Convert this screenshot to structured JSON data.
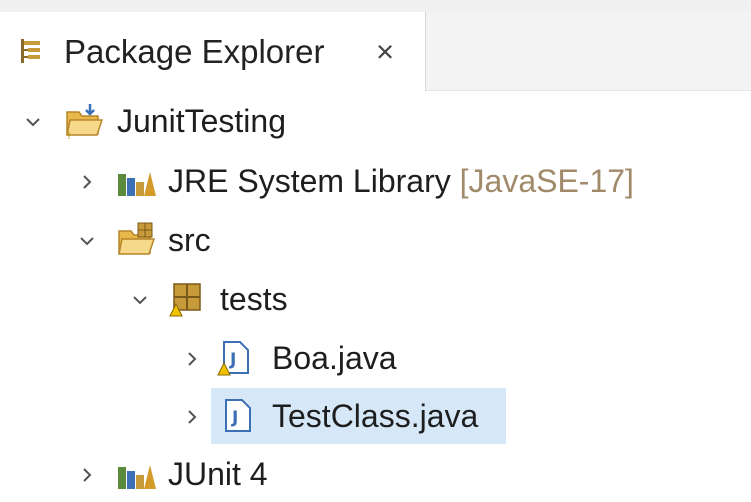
{
  "tab": {
    "title": "Package Explorer",
    "close_glyph": "×",
    "icon": "package-explorer-icon"
  },
  "tree": [
    {
      "name": "project-junittesting",
      "label": "JunitTesting",
      "decoration": "",
      "expanded": true,
      "icon": "java-project-icon"
    },
    {
      "name": "jre-system-library",
      "label": "JRE System Library",
      "decoration": "[JavaSE-17]",
      "expanded": false,
      "icon": "library-icon"
    },
    {
      "name": "src-folder",
      "label": "src",
      "decoration": "",
      "expanded": true,
      "icon": "source-folder-icon"
    },
    {
      "name": "package-tests",
      "label": "tests",
      "decoration": "",
      "expanded": true,
      "icon": "package-icon"
    },
    {
      "name": "file-boa-java",
      "label": "Boa.java",
      "decoration": "",
      "expanded": false,
      "icon": "java-file-warning-icon"
    },
    {
      "name": "file-testclass-java",
      "label": "TestClass.java",
      "decoration": "",
      "expanded": false,
      "selected": true,
      "icon": "java-file-icon"
    },
    {
      "name": "junit4-library",
      "label": "JUnit 4",
      "decoration": "",
      "expanded": false,
      "icon": "library-icon"
    }
  ],
  "colors": {
    "selection": "#d6e8f8",
    "decoration_text": "#a08a6a",
    "folder_yellow": "#e8b84a",
    "library_green": "#5b8a3c",
    "java_blue": "#3d6fb4"
  }
}
